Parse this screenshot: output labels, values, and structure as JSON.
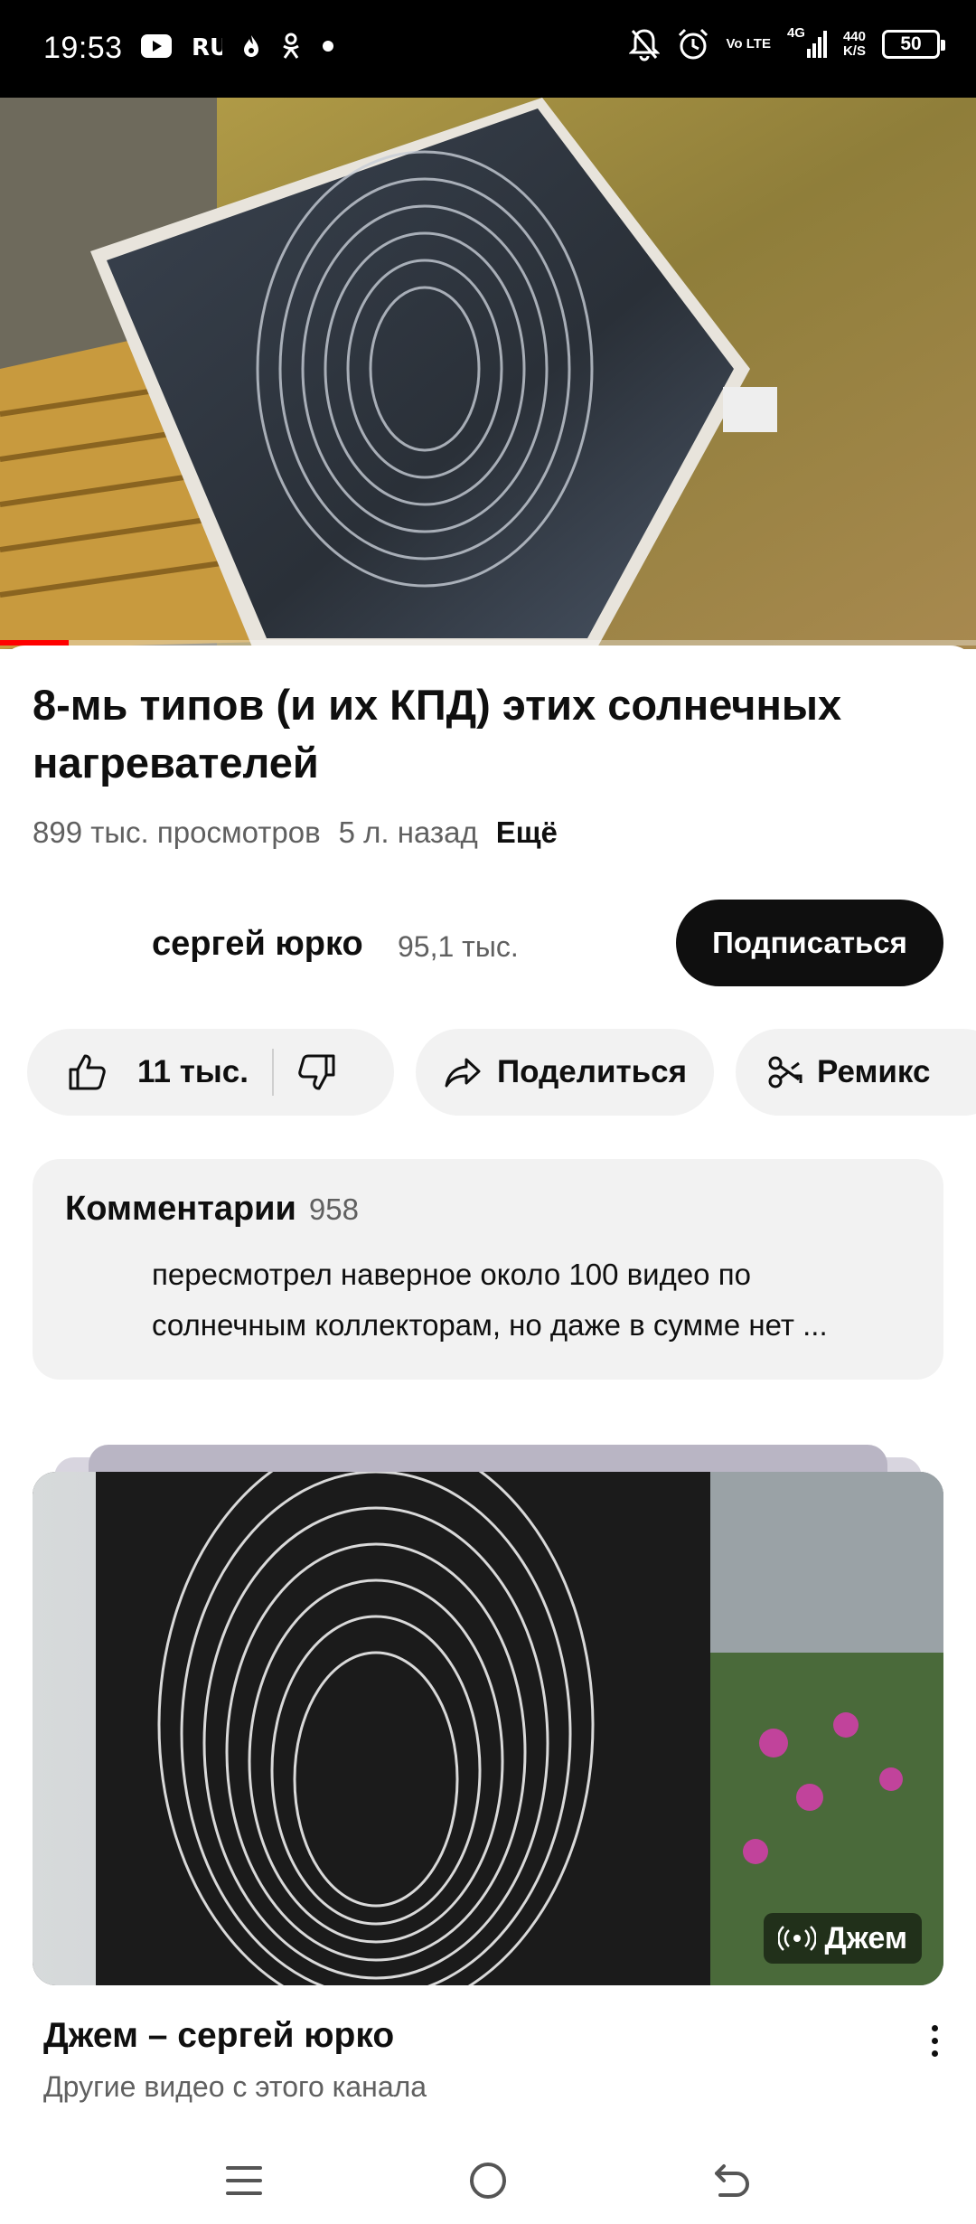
{
  "status_bar": {
    "time": "19:53",
    "left_icons": [
      "youtube-icon",
      "ru-app-icon",
      "fire-app-icon",
      "ok-icon",
      "dot-icon"
    ],
    "right_icons": [
      "mute-notifications-icon",
      "alarm-icon",
      "volte-icon",
      "signal-icon"
    ],
    "volte_label": "Vo LTE",
    "network_label": "4G",
    "net_speed_value": "440",
    "net_speed_unit": "K/S",
    "battery": "50"
  },
  "player": {
    "progress_fraction": 0.07
  },
  "video": {
    "title": "8-мь типов (и их КПД) этих солнечных нагревателей",
    "views": "899 тыс. просмотров",
    "age": "5 л. назад",
    "more_label": "Ещё"
  },
  "channel": {
    "name": "сергей юрко",
    "subscribers": "95,1 тыс.",
    "subscribe_label": "Подписаться"
  },
  "actions": {
    "likes": "11 тыс.",
    "share_label": "Поделиться",
    "remix_label": "Ремикс"
  },
  "comments": {
    "title": "Комментарии",
    "count": "958",
    "line1": "пересмотрел наверное около 100 видео по",
    "line2": "солнечным коллекторам, но даже в сумме нет ..."
  },
  "jam": {
    "badge_label": "Джем",
    "title": "Джем – сергей юрко",
    "subtitle": "Другие видео с этого канала"
  },
  "colors": {
    "accent_red": "#ff0000",
    "text_primary": "#0f0f0f",
    "text_secondary": "#606060",
    "pill_bg": "#f2f2f2"
  }
}
